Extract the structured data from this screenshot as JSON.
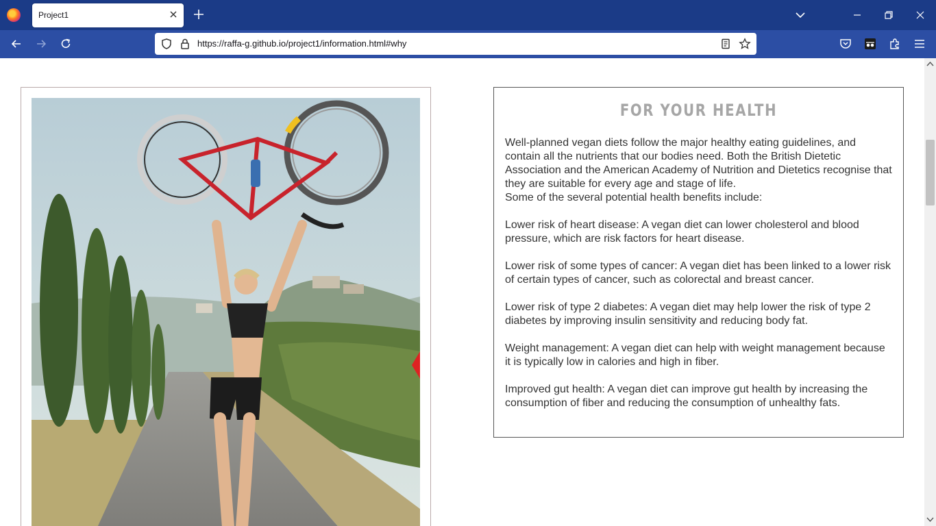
{
  "browser": {
    "tab_title": "Project1",
    "url": "https://raffa-g.github.io/project1/information.html#why"
  },
  "page": {
    "section_title": "FOR YOUR HEALTH",
    "intro_1": "Well-planned vegan diets follow the major healthy eating guidelines, and contain all the nutrients that our bodies need. Both the British Dietetic Association and the American Academy of Nutrition and Dietetics recognise that they are suitable for every age and stage of life.",
    "intro_2": "Some of the several potential health benefits include:",
    "benefits": [
      "Lower risk of heart disease: A vegan diet can lower cholesterol and blood pressure, which are risk factors for heart disease.",
      "Lower risk of some types of cancer: A vegan diet has been linked to a lower risk of certain types of cancer, such as colorectal and breast cancer.",
      "Lower risk of type 2 diabetes: A vegan diet may help lower the risk of type 2 diabetes by improving insulin sensitivity and reducing body fat.",
      "Weight management: A vegan diet can help with weight management because it is typically low in calories and high in fiber.",
      "Improved gut health: A vegan diet can improve gut health by increasing the consumption of fiber and reducing the consumption of unhealthy fats."
    ]
  },
  "colors": {
    "tabbar": "#1b3b87",
    "navbar": "#2c4ea4",
    "title_gray": "#a6a6a6"
  }
}
